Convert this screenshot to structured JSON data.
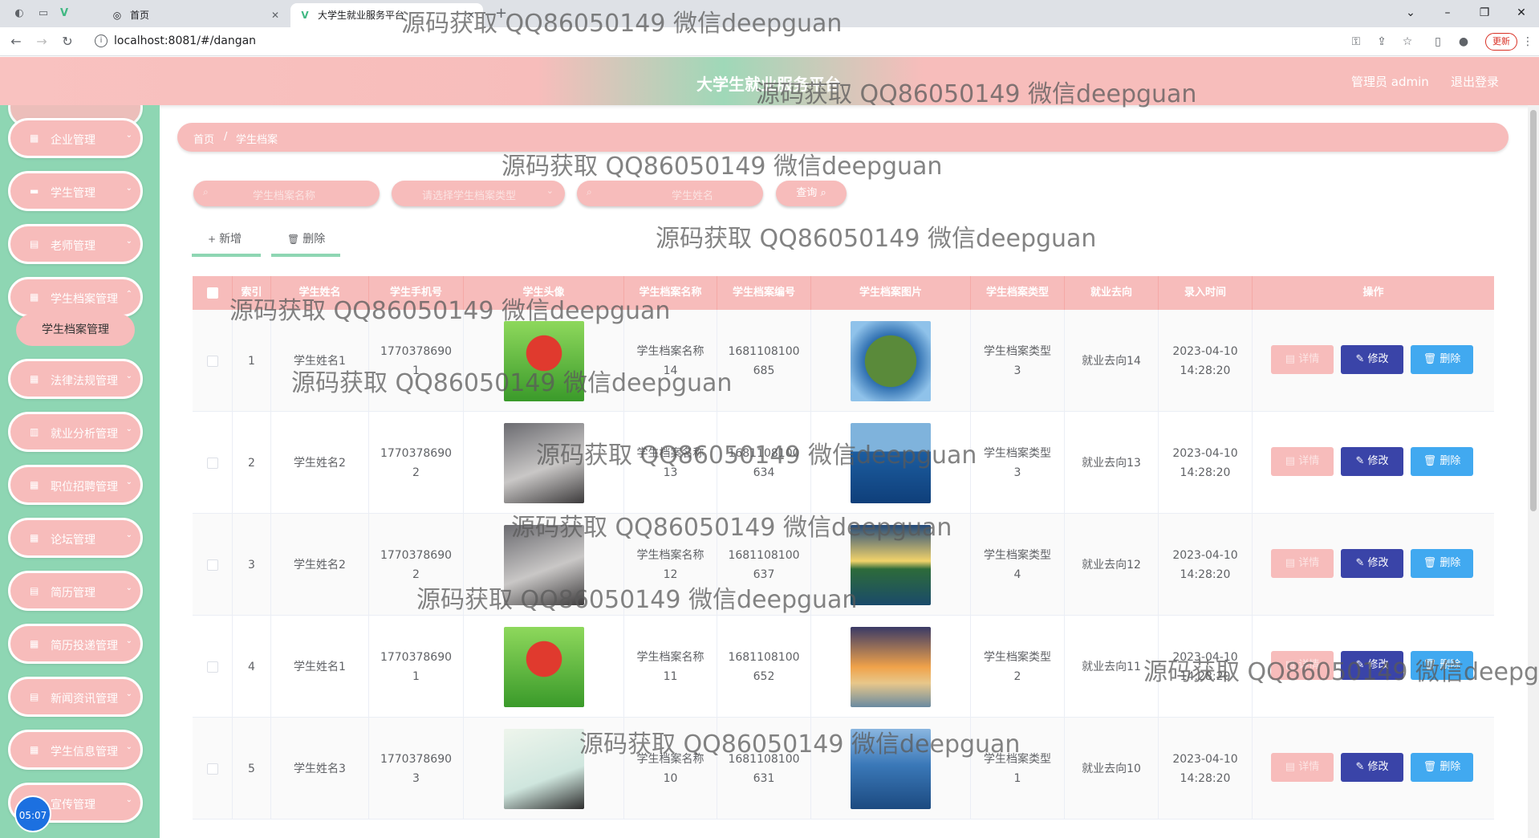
{
  "browser": {
    "tabs": [
      {
        "label": "首页",
        "active": false
      },
      {
        "label": "大学生就业服务平台",
        "active": true
      }
    ],
    "new_tab_glyph": "+",
    "url": "localhost:8081/#/dangan",
    "update_label": "更新"
  },
  "header": {
    "title": "大学生就业服务平台",
    "admin_label": "管理员 admin",
    "logout_label": "退出登录"
  },
  "sidebar": {
    "items": [
      {
        "label": "企业管理",
        "icon": "grid-icon"
      },
      {
        "label": "学生管理",
        "icon": "user-icon"
      },
      {
        "label": "老师管理",
        "icon": "doc-icon"
      },
      {
        "label": "学生档案管理",
        "icon": "grid-icon",
        "expanded": true
      },
      {
        "label": "法律法规管理",
        "icon": "grid-icon"
      },
      {
        "label": "就业分析管理",
        "icon": "chart-icon"
      },
      {
        "label": "职位招聘管理",
        "icon": "grid-icon"
      },
      {
        "label": "论坛管理",
        "icon": "grid-icon"
      },
      {
        "label": "简历管理",
        "icon": "doc-icon"
      },
      {
        "label": "简历投递管理",
        "icon": "grid-icon"
      },
      {
        "label": "新闻资讯管理",
        "icon": "doc-icon"
      },
      {
        "label": "学生信息管理",
        "icon": "grid-icon"
      },
      {
        "label": "宣传管理",
        "icon": "grid-icon"
      }
    ],
    "sub_item": "学生档案管理",
    "clock": "05:07"
  },
  "breadcrumb": {
    "home": "首页",
    "sep": "/",
    "current": "学生档案"
  },
  "search": {
    "name_placeholder": "学生档案名称",
    "type_placeholder": "请选择学生档案类型",
    "student_placeholder": "学生姓名",
    "query_label": "查询"
  },
  "actions": {
    "add_label": "新增",
    "delete_label": "删除"
  },
  "table": {
    "headers": [
      "索引",
      "学生姓名",
      "学生手机号",
      "学生头像",
      "学生档案名称",
      "学生档案编号",
      "学生档案图片",
      "学生档案类型",
      "就业去向",
      "录入时间",
      "操作"
    ],
    "rows": [
      {
        "index": "1",
        "name": "学生姓名1",
        "phone": "17703786901",
        "avatar": "cartoon",
        "archive_name": "学生档案名称14",
        "archive_no": "1681108100685",
        "photo": "planet",
        "type": "学生档案类型3",
        "dest": "就业去向14",
        "time": "2023-04-10 14:28:20"
      },
      {
        "index": "2",
        "name": "学生姓名2",
        "phone": "17703786902",
        "avatar": "girl1",
        "archive_name": "学生档案名称13",
        "archive_no": "1681108100634",
        "photo": "sea",
        "type": "学生档案类型3",
        "dest": "就业去向13",
        "time": "2023-04-10 14:28:20"
      },
      {
        "index": "3",
        "name": "学生姓名2",
        "phone": "17703786902",
        "avatar": "girl1",
        "archive_name": "学生档案名称12",
        "archive_no": "1681108100637",
        "photo": "lake",
        "type": "学生档案类型4",
        "dest": "就业去向12",
        "time": "2023-04-10 14:28:20"
      },
      {
        "index": "4",
        "name": "学生姓名1",
        "phone": "17703786901",
        "avatar": "cartoon",
        "archive_name": "学生档案名称11",
        "archive_no": "1681108100652",
        "photo": "sunset",
        "type": "学生档案类型2",
        "dest": "就业去向11",
        "time": "2023-04-10 14:28:20"
      },
      {
        "index": "5",
        "name": "学生姓名3",
        "phone": "17703786903",
        "avatar": "girl2",
        "archive_name": "学生档案名称10",
        "archive_no": "1681108100631",
        "photo": "field",
        "type": "学生档案类型1",
        "dest": "就业去向10",
        "time": "2023-04-10 14:28:20"
      }
    ],
    "btn_detail": "详情",
    "btn_edit": "修改",
    "btn_delete": "删除"
  },
  "watermark": "源码获取 QQ86050149 微信deepguan",
  "colors": {
    "pink": "#f7bcbb",
    "green": "#8ed6b3",
    "edit_blue": "#3a44a8",
    "delete_blue": "#41a9f0"
  }
}
